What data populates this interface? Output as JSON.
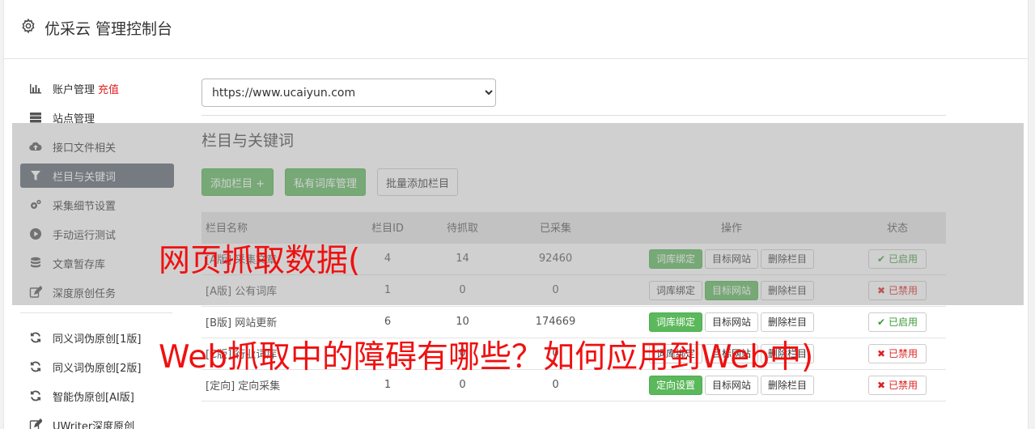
{
  "header": {
    "title": "优采云 管理控制台",
    "icon": "gear-icon"
  },
  "sidebar": {
    "items": [
      {
        "label": "账户管理",
        "icon": "bar-chart-icon",
        "extra": "充值"
      },
      {
        "label": "站点管理",
        "icon": "server-icon"
      },
      {
        "label": "接口文件相关",
        "icon": "cloud-upload-icon"
      },
      {
        "label": "栏目与关键词",
        "icon": "filter-icon",
        "active": true
      },
      {
        "label": "采集细节设置",
        "icon": "cogs-icon"
      },
      {
        "label": "手动运行测试",
        "icon": "play-circle-icon"
      },
      {
        "label": "文章暂存库",
        "icon": "database-icon"
      },
      {
        "label": "深度原创任务",
        "icon": "edit-icon"
      }
    ],
    "tools": [
      {
        "label": "同义词伪原创[1版]",
        "icon": "refresh-icon"
      },
      {
        "label": "同义词伪原创[2版]",
        "icon": "refresh-icon"
      },
      {
        "label": "智能伪原创[AI版]",
        "icon": "refresh-icon"
      },
      {
        "label": "UWriter深度原创",
        "icon": "edit-icon"
      }
    ]
  },
  "main": {
    "site_select": "https://www.ucaiyun.com",
    "section_title": "栏目与关键词",
    "buttons": {
      "add": "添加栏目 +",
      "private": "私有词库管理",
      "batch": "批量添加栏目"
    },
    "table": {
      "headers": [
        "栏目名称",
        "栏目ID",
        "待抓取",
        "已采集",
        "操作",
        "状态"
      ],
      "ops": {
        "bind": "词库绑定",
        "target": "目标网站",
        "delete": "删除栏目",
        "direct": "定向设置"
      },
      "status": {
        "on": "已启用",
        "off": "已禁用"
      },
      "rows": [
        {
          "tag": "[A版]",
          "name": "采集文章",
          "id": "4",
          "pending": "14",
          "collected": "92460",
          "status": "on",
          "style": "a"
        },
        {
          "tag": "[A版]",
          "name": "公有词库",
          "id": "1",
          "pending": "0",
          "collected": "0",
          "status": "off",
          "style": "a"
        },
        {
          "tag": "[B版]",
          "name": "网站更新",
          "id": "6",
          "pending": "10",
          "collected": "174669",
          "status": "on",
          "style": "b"
        },
        {
          "tag": "[C版]",
          "name": "行业词库",
          "id": "",
          "pending": "0",
          "collected": "0",
          "status": "off",
          "style": "c"
        },
        {
          "tag": "[定向]",
          "name": "定向采集",
          "id": "1",
          "pending": "0",
          "collected": "0",
          "status": "off",
          "style": "d"
        }
      ]
    }
  },
  "watermark": {
    "line1": "网页抓取数据(",
    "line2": "Web抓取中的障碍有哪些？如何应用到Web中)"
  },
  "colors": {
    "accent_green": "#5cb85c",
    "active_nav": "#5b6470",
    "watermark_red": "#f01010"
  }
}
